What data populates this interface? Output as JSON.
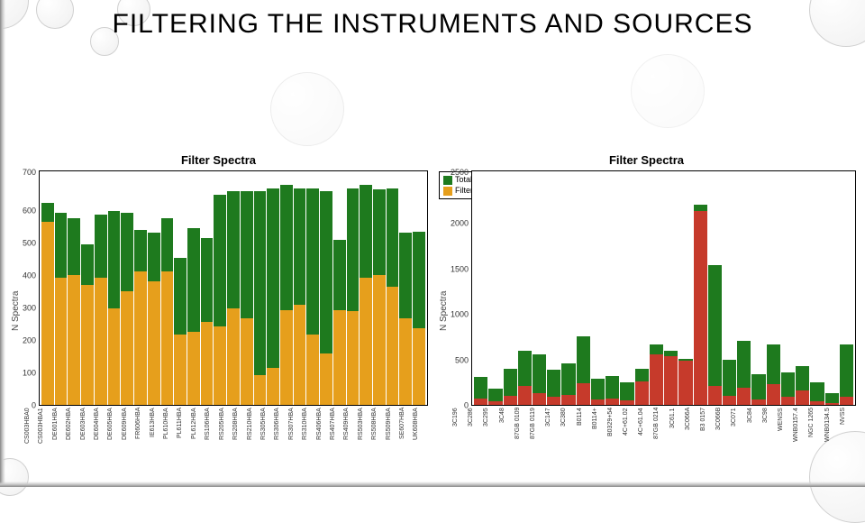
{
  "title": "FILTERING THE INSTRUMENTS AND SOURCES",
  "chart_data": [
    {
      "type": "bar",
      "title": "Filter Spectra",
      "ylabel": "N Spectra",
      "ylim": [
        0,
        700
      ],
      "yticks": [
        700,
        600,
        500,
        400,
        300,
        200,
        100,
        0
      ],
      "legend": [
        {
          "name": "Total",
          "color": "#1e7a1e"
        },
        {
          "name": "Filter",
          "color": "#e69f1c"
        }
      ],
      "categories": [
        "CS003HBA0",
        "CS003HBA1",
        "DE601HBA",
        "DE602HBA",
        "DE603HBA",
        "DE604HBA",
        "DE605HBA",
        "DE609HBA",
        "FR606HBA",
        "IE613HBA",
        "PL610HBA",
        "PL611HBA",
        "PL612HBA",
        "RS106HBA",
        "RS205HBA",
        "RS208HBA",
        "RS210HBA",
        "RS305HBA",
        "RS306HBA",
        "RS307HBA",
        "RS310HBA",
        "RS406HBA",
        "RS407HBA",
        "RS409HBA",
        "RS503HBA",
        "RS508HBA",
        "RS509HBA",
        "SE607HBA",
        "UK608HBA"
      ],
      "series": [
        {
          "name": "Total",
          "values": [
            605,
            575,
            560,
            480,
            570,
            580,
            575,
            525,
            515,
            560,
            440,
            530,
            500,
            630,
            640,
            640,
            640,
            650,
            660,
            650,
            650,
            640,
            495,
            650,
            660,
            645,
            650,
            515,
            520
          ]
        },
        {
          "name": "Filter",
          "values": [
            550,
            380,
            390,
            360,
            380,
            290,
            340,
            400,
            370,
            400,
            210,
            220,
            250,
            235,
            290,
            260,
            90,
            110,
            285,
            300,
            210,
            155,
            285,
            280,
            380,
            390,
            355,
            260,
            230
          ]
        }
      ]
    },
    {
      "type": "bar",
      "title": "Filter Spectra",
      "ylabel": "N Spectra",
      "ylim": [
        0,
        2500
      ],
      "yticks": [
        2500,
        2000,
        1500,
        1000,
        500,
        0
      ],
      "legend": [
        {
          "name": "Total",
          "color": "#1e7a1e"
        },
        {
          "name": "Filter",
          "color": "#c63a2b"
        }
      ],
      "categories": [
        "3C196",
        "3C286",
        "3C295",
        "3C48",
        "87GB 0109",
        "87GB 0119",
        "3C147",
        "3C380",
        "B0114",
        "B0114+",
        "B0329+54",
        "4C+61.02",
        "4C+61.04",
        "87GB 0214",
        "3C61.1",
        "3C066A",
        "B3 0157",
        "3C066B",
        "3C071",
        "3C84",
        "3C98",
        "WENSS",
        "WNB0157.4",
        "NGC 1265",
        "WNB0134.5",
        "NVSS"
      ],
      "series": [
        {
          "name": "Total",
          "values": [
            300,
            170,
            390,
            580,
            540,
            380,
            440,
            730,
            280,
            305,
            240,
            390,
            650,
            580,
            490,
            2140,
            1500,
            480,
            690,
            330,
            650,
            350,
            420,
            240,
            130,
            650
          ]
        },
        {
          "name": "Filter",
          "values": [
            70,
            40,
            100,
            200,
            130,
            90,
            110,
            230,
            60,
            65,
            50,
            250,
            540,
            520,
            470,
            2080,
            200,
            100,
            180,
            60,
            220,
            90,
            150,
            40,
            20,
            90
          ]
        }
      ]
    }
  ]
}
